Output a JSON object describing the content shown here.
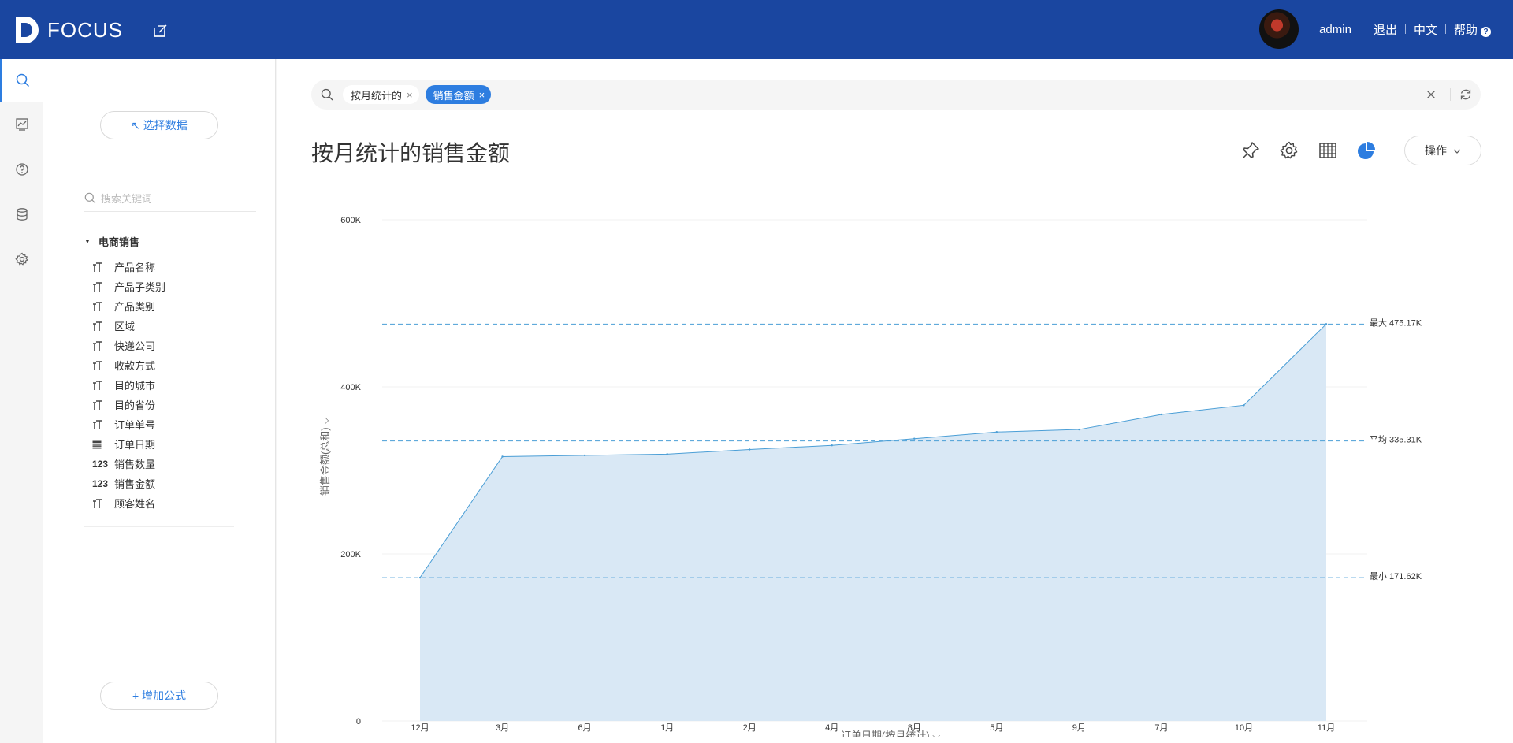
{
  "header": {
    "logo_text": "FOCUS",
    "user": "admin",
    "logout": "退出",
    "language": "中文",
    "help": "帮助",
    "help_icon_char": "?",
    "brand_color": "#1a46a0"
  },
  "rail": {
    "items": [
      "search-icon",
      "chart-board-icon",
      "help-icon",
      "database-icon",
      "settings-icon"
    ],
    "active": "search-icon"
  },
  "panel": {
    "select_data": "↖ 选择数据",
    "search_placeholder": "搜索关键词",
    "tree_title": "电商销售",
    "fields": [
      {
        "type": "text",
        "type_label": "T",
        "name": "产品名称"
      },
      {
        "type": "text",
        "type_label": "T",
        "name": "产品子类别"
      },
      {
        "type": "text",
        "type_label": "T",
        "name": "产品类别"
      },
      {
        "type": "text",
        "type_label": "T",
        "name": "区域"
      },
      {
        "type": "text",
        "type_label": "T",
        "name": "快递公司"
      },
      {
        "type": "text",
        "type_label": "T",
        "name": "收款方式"
      },
      {
        "type": "text",
        "type_label": "T",
        "name": "目的城市"
      },
      {
        "type": "text",
        "type_label": "T",
        "name": "目的省份"
      },
      {
        "type": "text",
        "type_label": "T",
        "name": "订单单号"
      },
      {
        "type": "date",
        "type_label": "",
        "name": "订单日期"
      },
      {
        "type": "number",
        "type_label": "123",
        "name": "销售数量"
      },
      {
        "type": "number",
        "type_label": "123",
        "name": "销售金额"
      },
      {
        "type": "text",
        "type_label": "T",
        "name": "顾客姓名"
      }
    ],
    "add_formula": "+ 增加公式"
  },
  "searchbar": {
    "tokens": [
      {
        "label": "按月统计的",
        "style": "plain"
      },
      {
        "label": "销售金额",
        "style": "blue"
      }
    ],
    "close_char": "×"
  },
  "main": {
    "title": "按月统计的销售金额",
    "ops_label": "操作",
    "accent": "#2d7de0"
  },
  "chart_data": {
    "type": "area",
    "categories": [
      "12月",
      "3月",
      "6月",
      "1月",
      "2月",
      "4月",
      "8月",
      "5月",
      "9月",
      "7月",
      "10月",
      "11月"
    ],
    "series": [
      {
        "values": [
          171.62,
          316.5,
          318.0,
          319.5,
          325.0,
          330.0,
          338.0,
          346.0,
          349.0,
          367.0,
          378.0,
          475.17
        ]
      }
    ],
    "y_ticks": [
      "0",
      "200K",
      "400K",
      "600K"
    ],
    "ylim": [
      0,
      600
    ],
    "y_unit": "K",
    "xlabel": "订单日期(按月统计)",
    "ylabel": "销售金额(总和)",
    "reference_lines": [
      {
        "label": "最大 475.17K",
        "value": 475.17
      },
      {
        "label": "平均 335.31K",
        "value": 335.31
      },
      {
        "label": "最小 171.62K",
        "value": 171.62
      }
    ],
    "fill_color": "#d9e8f5",
    "line_color": "#4a9ed6",
    "ref_color": "#4a9ed6"
  }
}
